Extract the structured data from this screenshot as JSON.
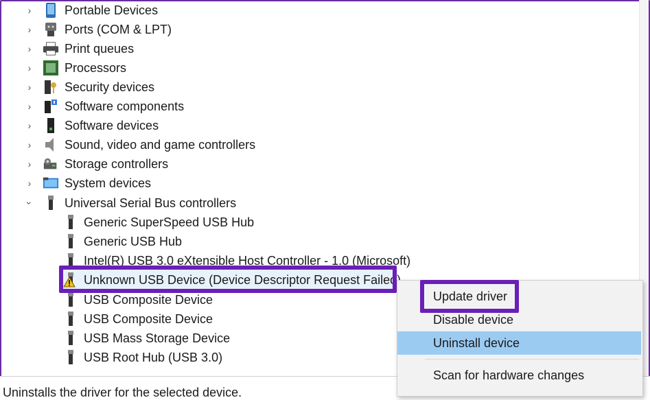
{
  "tree": {
    "categories": [
      {
        "label": "Portable Devices",
        "icon": "portable-devices-icon"
      },
      {
        "label": "Ports (COM & LPT)",
        "icon": "ports-icon"
      },
      {
        "label": "Print queues",
        "icon": "printer-icon"
      },
      {
        "label": "Processors",
        "icon": "processor-icon"
      },
      {
        "label": "Security devices",
        "icon": "security-device-icon"
      },
      {
        "label": "Software components",
        "icon": "software-component-icon"
      },
      {
        "label": "Software devices",
        "icon": "software-device-icon"
      },
      {
        "label": "Sound, video and game controllers",
        "icon": "speaker-icon"
      },
      {
        "label": "Storage controllers",
        "icon": "storage-controller-icon"
      },
      {
        "label": "System devices",
        "icon": "system-devices-icon"
      }
    ],
    "expanded_category": {
      "label": "Universal Serial Bus controllers",
      "icon": "usb-icon"
    },
    "devices": [
      {
        "label": "Generic SuperSpeed USB Hub",
        "icon": "usb-plug-icon"
      },
      {
        "label": "Generic USB Hub",
        "icon": "usb-plug-icon"
      },
      {
        "label": "Intel(R) USB 3.0 eXtensible Host Controller - 1.0 (Microsoft)",
        "icon": "usb-plug-icon"
      },
      {
        "label": "Unknown USB Device (Device Descriptor Request Failed)",
        "icon": "warning-icon"
      },
      {
        "label": "USB Composite Device",
        "icon": "usb-plug-icon"
      },
      {
        "label": "USB Composite Device",
        "icon": "usb-plug-icon"
      },
      {
        "label": "USB Mass Storage Device",
        "icon": "usb-plug-icon"
      },
      {
        "label": "USB Root Hub (USB 3.0)",
        "icon": "usb-plug-icon"
      }
    ]
  },
  "context_menu": {
    "update_driver": "Update driver",
    "disable_device": "Disable device",
    "uninstall_device": "Uninstall device",
    "scan_hardware": "Scan for hardware changes"
  },
  "status_bar": {
    "text": "Uninstalls the driver for the selected device."
  },
  "colors": {
    "highlight_border": "#6a1fb8",
    "menu_highlight": "#9ccbf2",
    "frame": "#6a2ca0"
  }
}
